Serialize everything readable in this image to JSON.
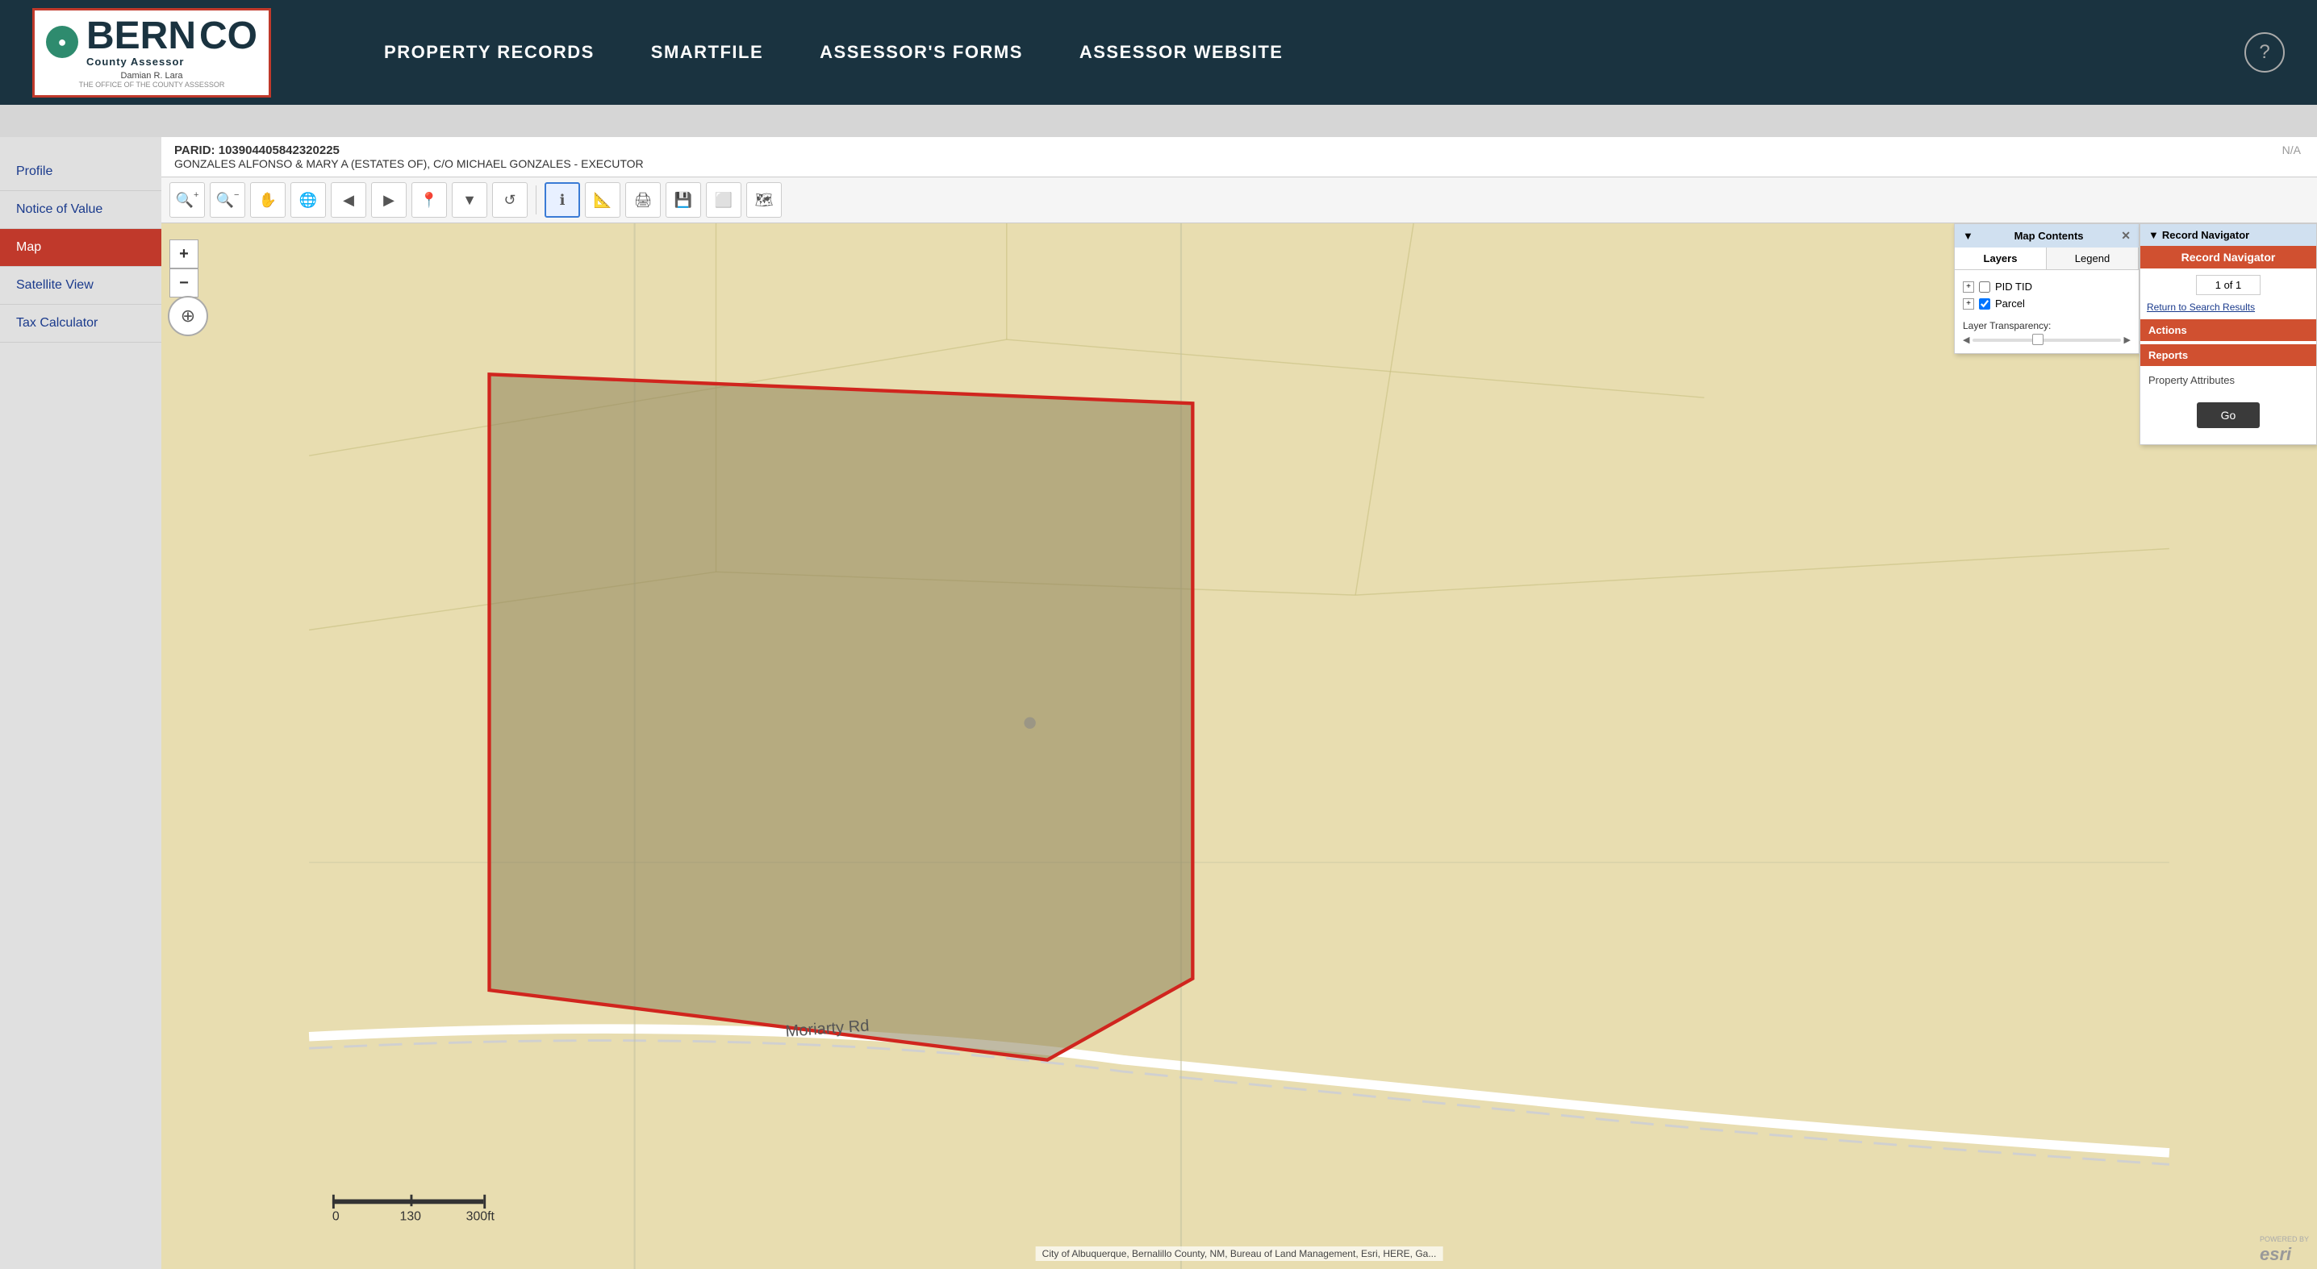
{
  "header": {
    "logo": {
      "line1": "BERN",
      "line2": "CO",
      "sub": "County Assessor",
      "person": "Damian R. Lara",
      "role": "THE OFFICE OF THE COUNTY ASSESSOR"
    },
    "nav": [
      {
        "label": "PROPERTY RECORDS",
        "id": "property-records"
      },
      {
        "label": "SMARTFILE",
        "id": "smartfile"
      },
      {
        "label": "ASSESSOR'S FORMS",
        "id": "assessors-forms"
      },
      {
        "label": "ASSESSOR WEBSITE",
        "id": "assessor-website"
      }
    ],
    "help_label": "?"
  },
  "sidebar": {
    "items": [
      {
        "label": "Profile",
        "id": "profile",
        "active": false
      },
      {
        "label": "Notice of Value",
        "id": "notice-of-value",
        "active": false
      },
      {
        "label": "Map",
        "id": "map",
        "active": true
      },
      {
        "label": "Satellite View",
        "id": "satellite-view",
        "active": false
      },
      {
        "label": "Tax Calculator",
        "id": "tax-calculator",
        "active": false
      }
    ]
  },
  "map_info": {
    "parid_label": "PARID:",
    "parid_value": "103904405842320225",
    "owner": "GONZALES ALFONSO & MARY A (ESTATES OF), C/O MICHAEL GONZALES - EXECUTOR",
    "na_badge": "N/A"
  },
  "toolbar": {
    "buttons": [
      {
        "icon": "🔍+",
        "label": "zoom-in",
        "title": "Zoom In"
      },
      {
        "icon": "🔍-",
        "label": "zoom-out",
        "title": "Zoom Out"
      },
      {
        "icon": "✋",
        "label": "pan",
        "title": "Pan"
      },
      {
        "icon": "🌐",
        "label": "globe",
        "title": "Globe"
      },
      {
        "icon": "◀",
        "label": "prev",
        "title": "Previous"
      },
      {
        "icon": "▶",
        "label": "next",
        "title": "Next"
      },
      {
        "icon": "📍",
        "label": "bookmark",
        "title": "Bookmark"
      },
      {
        "icon": "▼",
        "label": "dropdown",
        "title": "Dropdown"
      },
      {
        "icon": "↺",
        "label": "select",
        "title": "Select"
      },
      {
        "icon": "ℹ",
        "label": "info",
        "title": "Info",
        "active": true
      },
      {
        "icon": "📐",
        "label": "measure",
        "title": "Measure"
      },
      {
        "icon": "🖨",
        "label": "print",
        "title": "Print"
      },
      {
        "icon": "💾",
        "label": "export",
        "title": "Export"
      },
      {
        "icon": "⬜",
        "label": "window",
        "title": "Window"
      },
      {
        "icon": "🗺",
        "label": "layers",
        "title": "Layers"
      }
    ]
  },
  "map_contents": {
    "title": "Map Contents",
    "tabs": [
      {
        "label": "Layers",
        "active": true
      },
      {
        "label": "Legend",
        "active": false
      }
    ],
    "layers": [
      {
        "name": "PID TID",
        "checked": false,
        "expanded": false
      },
      {
        "name": "Parcel",
        "checked": true,
        "expanded": false
      }
    ],
    "transparency_label": "Layer Transparency:"
  },
  "record_navigator": {
    "panel_title": "Record Navigator",
    "title_bar": "Record Navigator",
    "nav_value": "1 of 1",
    "return_link": "Return to Search Results",
    "actions_label": "Actions",
    "reports_label": "Reports",
    "property_attributes_label": "Property Attributes",
    "go_button": "Go"
  },
  "map_view": {
    "zoom_in": "+",
    "zoom_out": "−",
    "attribution": "City of Albuquerque, Bernalillo County, NM, Bureau of Land Management, Esri, HERE, Ga...",
    "road_label": "Moriarty Rd",
    "scale_label": "300ft",
    "scale_marks": "0   130   300ft"
  }
}
